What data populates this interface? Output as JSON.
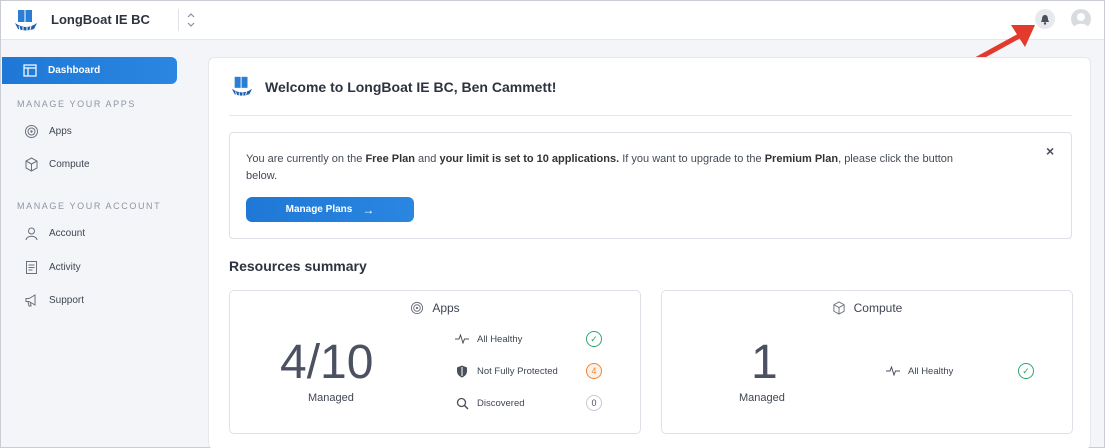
{
  "header": {
    "app_name": "LongBoat IE BC"
  },
  "sidebar": {
    "active": {
      "label": "Dashboard",
      "icon": "dashboard-icon"
    },
    "sections": [
      {
        "title": "MANAGE YOUR APPS",
        "items": [
          {
            "label": "Apps",
            "icon": "apps-icon"
          },
          {
            "label": "Compute",
            "icon": "compute-icon"
          }
        ]
      },
      {
        "title": "MANAGE YOUR ACCOUNT",
        "items": [
          {
            "label": "Account",
            "icon": "account-icon"
          },
          {
            "label": "Activity",
            "icon": "activity-icon"
          },
          {
            "label": "Support",
            "icon": "support-icon"
          }
        ]
      }
    ]
  },
  "main": {
    "welcome": "Welcome to LongBoat IE BC, Ben Cammett!",
    "notice": {
      "t1": "You are currently on the ",
      "b1": "Free Plan",
      "t2": " and ",
      "b2": "your limit is set to 10 applications.",
      "t3": " If you want to upgrade to the ",
      "b3": "Premium Plan",
      "t4": ", please click the button below.",
      "button": "Manage Plans",
      "button_arrow": "→",
      "close": "×"
    },
    "resources_title": "Resources summary",
    "apps": {
      "title": "Apps",
      "count": "4/10",
      "count_label": "Managed",
      "stats": [
        {
          "label": "All Healthy",
          "badge": "✓",
          "color": "#2fa66a"
        },
        {
          "label": "Not Fully Protected",
          "badge": "4",
          "color": "#e8863a"
        },
        {
          "label": "Discovered",
          "badge": "0",
          "color": "#9aa0aa"
        }
      ]
    },
    "compute": {
      "title": "Compute",
      "count": "1",
      "count_label": "Managed",
      "stat": {
        "label": "All Healthy",
        "badge": "✓",
        "color": "#2fa66a"
      }
    }
  },
  "colors": {
    "accent": "#1f78d6",
    "annotation_arrow": "#e23b2e"
  }
}
